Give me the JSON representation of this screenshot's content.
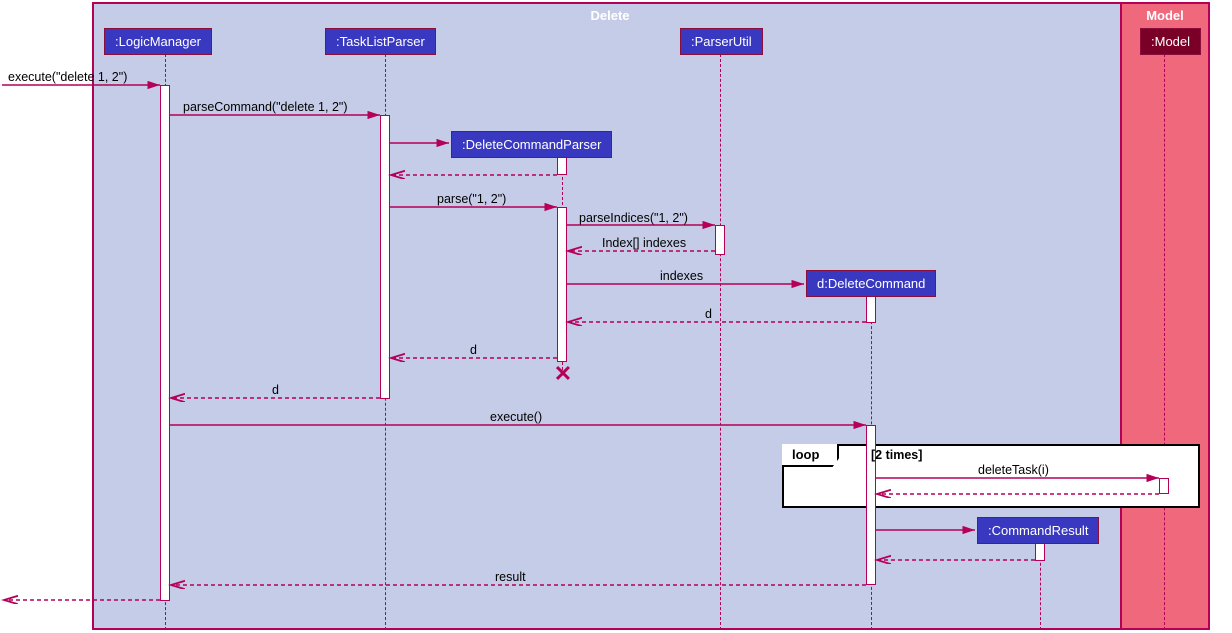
{
  "frames": {
    "delete": "Delete",
    "model": "Model"
  },
  "participants": {
    "logicManager": ":LogicManager",
    "taskListParser": ":TaskListParser",
    "deleteCommandParser": ":DeleteCommandParser",
    "parserUtil": ":ParserUtil",
    "deleteCommand": "d:DeleteCommand",
    "commandResult": ":CommandResult",
    "model": ":Model"
  },
  "messages": {
    "m1": "execute(\"delete 1, 2\")",
    "m2": "parseCommand(\"delete 1, 2\")",
    "m3": "parse(\"1, 2\")",
    "m4": "parseIndices(\"1, 2\")",
    "m5": "Index[] indexes",
    "m6": "indexes",
    "m7": "d",
    "m8": "d",
    "m9": "d",
    "m10": "execute()",
    "loop_label": "loop",
    "loop_cond": "[2 times]",
    "m11": "deleteTask(i)",
    "m12": "result"
  },
  "chart_data": {
    "type": "sequence-diagram",
    "frames": [
      {
        "name": "Delete",
        "contains": [
          ":LogicManager",
          ":TaskListParser",
          ":DeleteCommandParser",
          ":ParserUtil",
          "d:DeleteCommand",
          ":CommandResult"
        ]
      },
      {
        "name": "Model",
        "contains": [
          ":Model"
        ]
      }
    ],
    "participants": [
      ":LogicManager",
      ":TaskListParser",
      ":DeleteCommandParser",
      ":ParserUtil",
      "d:DeleteCommand",
      ":CommandResult",
      ":Model"
    ],
    "messages": [
      {
        "from": "external",
        "to": ":LogicManager",
        "label": "execute(\"delete 1, 2\")",
        "type": "sync"
      },
      {
        "from": ":LogicManager",
        "to": ":TaskListParser",
        "label": "parseCommand(\"delete 1, 2\")",
        "type": "sync"
      },
      {
        "from": ":TaskListParser",
        "to": ":DeleteCommandParser",
        "label": "",
        "type": "create"
      },
      {
        "from": ":DeleteCommandParser",
        "to": ":TaskListParser",
        "label": "",
        "type": "return"
      },
      {
        "from": ":TaskListParser",
        "to": ":DeleteCommandParser",
        "label": "parse(\"1, 2\")",
        "type": "sync"
      },
      {
        "from": ":DeleteCommandParser",
        "to": ":ParserUtil",
        "label": "parseIndices(\"1, 2\")",
        "type": "sync"
      },
      {
        "from": ":ParserUtil",
        "to": ":DeleteCommandParser",
        "label": "Index[] indexes",
        "type": "return"
      },
      {
        "from": ":DeleteCommandParser",
        "to": "d:DeleteCommand",
        "label": "indexes",
        "type": "create"
      },
      {
        "from": "d:DeleteCommand",
        "to": ":DeleteCommandParser",
        "label": "d",
        "type": "return"
      },
      {
        "from": ":DeleteCommandParser",
        "to": ":TaskListParser",
        "label": "d",
        "type": "return"
      },
      {
        "from": ":DeleteCommandParser",
        "to": null,
        "label": "",
        "type": "destroy"
      },
      {
        "from": ":TaskListParser",
        "to": ":LogicManager",
        "label": "d",
        "type": "return"
      },
      {
        "from": ":LogicManager",
        "to": "d:DeleteCommand",
        "label": "execute()",
        "type": "sync"
      },
      {
        "loop": "[2 times]",
        "messages": [
          {
            "from": "d:DeleteCommand",
            "to": ":Model",
            "label": "deleteTask(i)",
            "type": "sync"
          },
          {
            "from": ":Model",
            "to": "d:DeleteCommand",
            "label": "",
            "type": "return"
          }
        ]
      },
      {
        "from": "d:DeleteCommand",
        "to": ":CommandResult",
        "label": "",
        "type": "create"
      },
      {
        "from": ":CommandResult",
        "to": "d:DeleteCommand",
        "label": "",
        "type": "return"
      },
      {
        "from": "d:DeleteCommand",
        "to": ":LogicManager",
        "label": "result",
        "type": "return"
      },
      {
        "from": ":LogicManager",
        "to": "external",
        "label": "",
        "type": "return"
      }
    ]
  }
}
